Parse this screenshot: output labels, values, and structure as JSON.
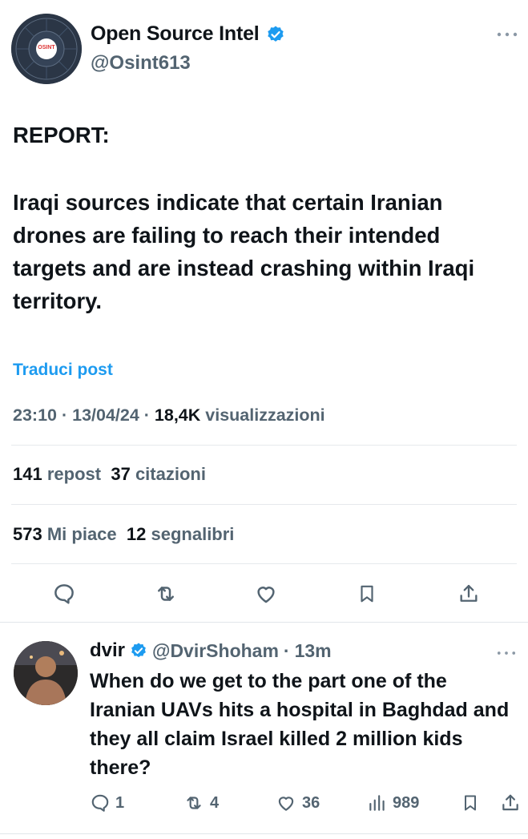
{
  "tweet": {
    "author_name": "Open Source Intel",
    "author_handle": "@Osint613",
    "avatar_label": "OSINT",
    "more_icon": "more-horizontal-icon",
    "verified_color": "#1d9bf0",
    "heading": "REPORT:",
    "body": "Iraqi sources indicate that certain Iranian drones are failing to reach their intended targets and are instead crashing within Iraqi territory.",
    "translate_label": "Traduci post",
    "time": "23:10",
    "date": "13/04/24",
    "views_count": "18,4K",
    "views_label": "visualizzazioni",
    "reposts_count": "141",
    "reposts_label": "repost",
    "quotes_count": "37",
    "quotes_label": "citazioni",
    "likes_count": "573",
    "likes_label": "Mi piace",
    "bookmarks_count": "12",
    "bookmarks_label": "segnalibri"
  },
  "reply": {
    "author_name": "dvir",
    "author_handle": "@DvirShoham",
    "time_ago": "13m",
    "text": "When do we get to the part one of the Iranian UAVs hits a hospital in Baghdad and they all claim Israel killed 2 million kids there?",
    "replies": "1",
    "reposts": "4",
    "likes": "36",
    "views": "989"
  },
  "colors": {
    "accent": "#1d9bf0",
    "text": "#0f1419",
    "muted": "#536471"
  }
}
